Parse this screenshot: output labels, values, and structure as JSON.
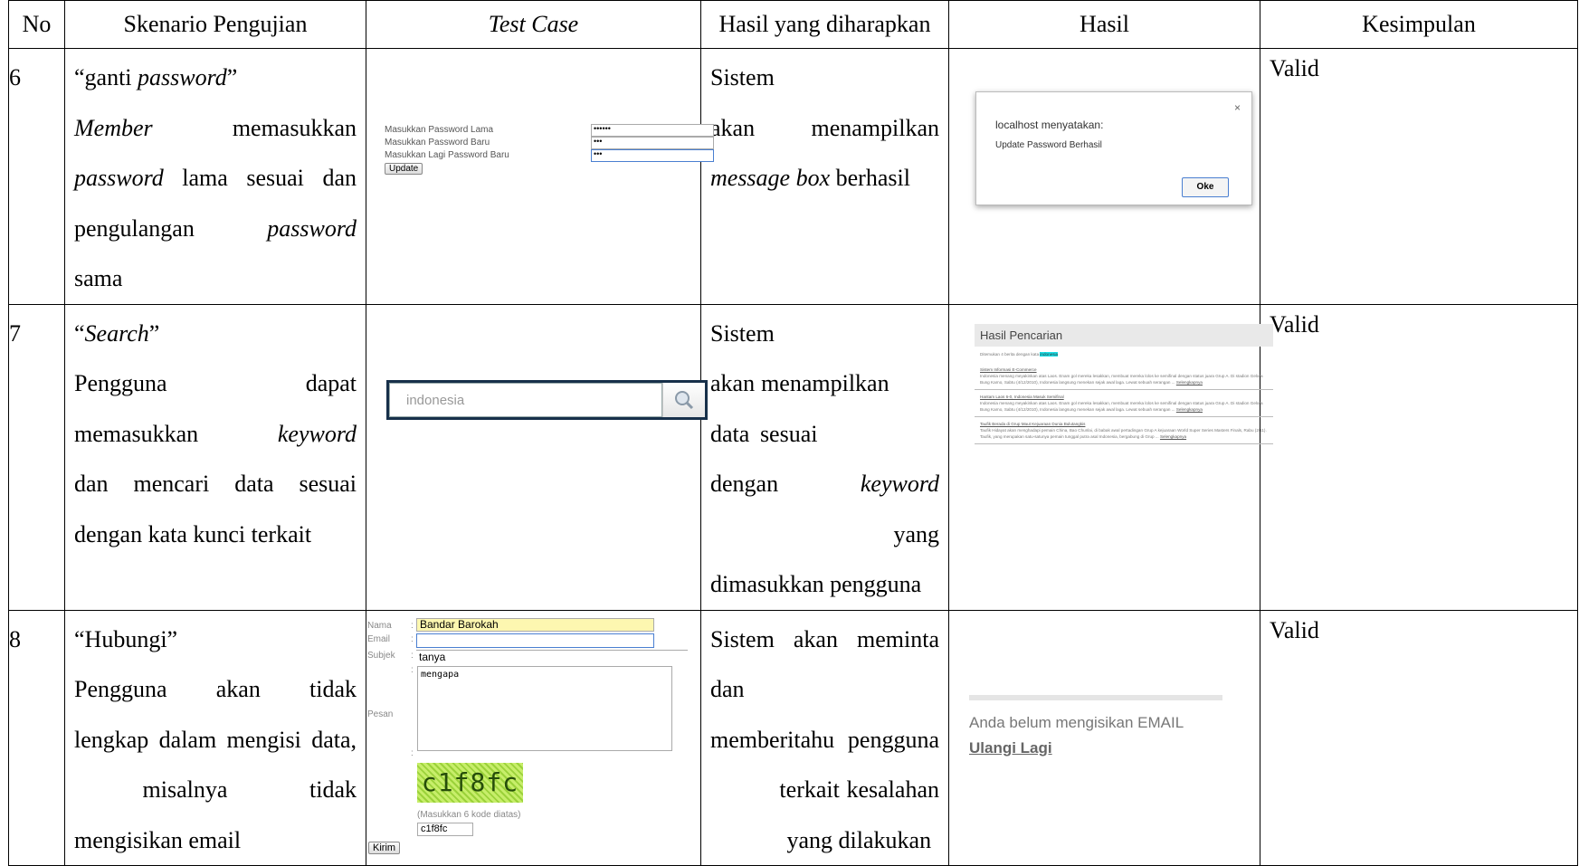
{
  "headers": {
    "no": "No",
    "skenario": "Skenario Pengujian",
    "test_case": "Test Case",
    "expected": "Hasil yang diharapkan",
    "hasil": "Hasil",
    "kesimpulan": "Kesimpulan"
  },
  "rows": [
    {
      "no": "6",
      "kesimpulan": "Valid",
      "testcase": {
        "label1": "Masukkan Password Lama",
        "label2": "Masukkan Password Baru",
        "label3": "Masukkan Lagi Password Baru",
        "value1": "••••••",
        "value2": "•••",
        "value3": "•••",
        "button": "Update"
      },
      "hasil": {
        "dialog_title": "localhost menyatakan:",
        "dialog_message": "Update Password Berhasil",
        "close": "×",
        "ok": "Oke"
      }
    },
    {
      "no": "7",
      "kesimpulan": "Valid",
      "testcase": {
        "search_value": "indonesia"
      },
      "hasil": {
        "header": "Hasil Pencarian",
        "info_prefix": "Ditemukan 4 berita dengan kata",
        "info_keyword": "indonesia",
        "items": [
          {
            "title": "Sistem Informasi E-Commerce",
            "text": "Indonesia menang meyakinkan atas Laos. Enam gol mereka lesakkan, membuat mereka lolos ke semifinal dengan status juara Grup A. Di stadion Gelora Bung Karno, Sabtu (4/12/2010), Indonesia langsung menekan sejak awal laga. Lewat sebuah serangan ...",
            "more": "Selengkapnya"
          },
          {
            "title": "Hantam Laos 6-0, Indonesia Masuk Semifinal",
            "text": "Indonesia menang meyakinkan atas Laos. Enam gol mereka lesakkan, membuat mereka lolos ke semifinal dengan status juara Grup A. Di stadion Gelora Bung Karno, Sabtu (4/12/2010), Indonesia langsung menekan sejak awal laga. Lewat sebuah serangan ...",
            "more": "Selengkapnya"
          },
          {
            "title": "Taufik Berada di Grup Maut Kejuaraan Dunia Bulutangkis",
            "text": "Taufik Hidayat akan menghadapi pemain China, Bao Chunlai, di babak awal pertadingan Grup A kejuaraan World Super Series Masters Finals, Rabu (2/11). Taufik, yang merupakan satu-satunya pemain tunggal putra asal Indonesia, bergabung di Grup ...",
            "more": "Selengkapnya"
          }
        ]
      }
    },
    {
      "no": "8",
      "kesimpulan": "Valid",
      "testcase": {
        "label_nama": "Nama",
        "label_email": "Email",
        "label_subjek": "Subjek",
        "label_pesan": "Pesan",
        "colon": ":",
        "value_nama": "Bandar Barokah",
        "value_email": "",
        "value_subjek": "tanya",
        "value_pesan": "mengapa",
        "captcha": "c1f8fc",
        "captcha_hint": "(Masukkan 6 kode diatas)",
        "captcha_input": "c1f8fc",
        "button": "Kirim"
      },
      "hasil": {
        "error": "Anda belum mengisikan EMAIL",
        "link": "Ulangi Lagi"
      }
    }
  ]
}
